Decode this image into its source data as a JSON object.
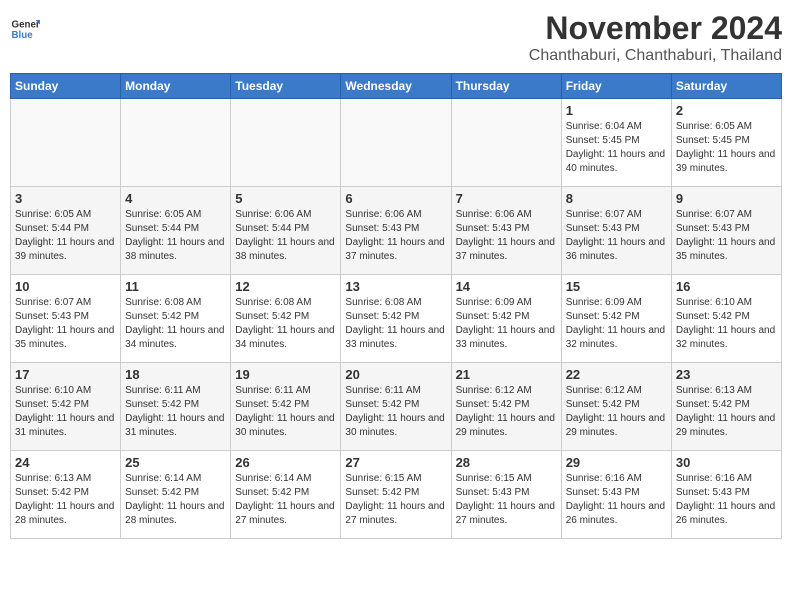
{
  "header": {
    "logo_general": "General",
    "logo_blue": "Blue",
    "title": "November 2024",
    "subtitle": "Chanthaburi, Chanthaburi, Thailand"
  },
  "days_of_week": [
    "Sunday",
    "Monday",
    "Tuesday",
    "Wednesday",
    "Thursday",
    "Friday",
    "Saturday"
  ],
  "weeks": [
    [
      {
        "day": "",
        "detail": ""
      },
      {
        "day": "",
        "detail": ""
      },
      {
        "day": "",
        "detail": ""
      },
      {
        "day": "",
        "detail": ""
      },
      {
        "day": "",
        "detail": ""
      },
      {
        "day": "1",
        "detail": "Sunrise: 6:04 AM\nSunset: 5:45 PM\nDaylight: 11 hours and 40 minutes."
      },
      {
        "day": "2",
        "detail": "Sunrise: 6:05 AM\nSunset: 5:45 PM\nDaylight: 11 hours and 39 minutes."
      }
    ],
    [
      {
        "day": "3",
        "detail": "Sunrise: 6:05 AM\nSunset: 5:44 PM\nDaylight: 11 hours and 39 minutes."
      },
      {
        "day": "4",
        "detail": "Sunrise: 6:05 AM\nSunset: 5:44 PM\nDaylight: 11 hours and 38 minutes."
      },
      {
        "day": "5",
        "detail": "Sunrise: 6:06 AM\nSunset: 5:44 PM\nDaylight: 11 hours and 38 minutes."
      },
      {
        "day": "6",
        "detail": "Sunrise: 6:06 AM\nSunset: 5:43 PM\nDaylight: 11 hours and 37 minutes."
      },
      {
        "day": "7",
        "detail": "Sunrise: 6:06 AM\nSunset: 5:43 PM\nDaylight: 11 hours and 37 minutes."
      },
      {
        "day": "8",
        "detail": "Sunrise: 6:07 AM\nSunset: 5:43 PM\nDaylight: 11 hours and 36 minutes."
      },
      {
        "day": "9",
        "detail": "Sunrise: 6:07 AM\nSunset: 5:43 PM\nDaylight: 11 hours and 35 minutes."
      }
    ],
    [
      {
        "day": "10",
        "detail": "Sunrise: 6:07 AM\nSunset: 5:43 PM\nDaylight: 11 hours and 35 minutes."
      },
      {
        "day": "11",
        "detail": "Sunrise: 6:08 AM\nSunset: 5:42 PM\nDaylight: 11 hours and 34 minutes."
      },
      {
        "day": "12",
        "detail": "Sunrise: 6:08 AM\nSunset: 5:42 PM\nDaylight: 11 hours and 34 minutes."
      },
      {
        "day": "13",
        "detail": "Sunrise: 6:08 AM\nSunset: 5:42 PM\nDaylight: 11 hours and 33 minutes."
      },
      {
        "day": "14",
        "detail": "Sunrise: 6:09 AM\nSunset: 5:42 PM\nDaylight: 11 hours and 33 minutes."
      },
      {
        "day": "15",
        "detail": "Sunrise: 6:09 AM\nSunset: 5:42 PM\nDaylight: 11 hours and 32 minutes."
      },
      {
        "day": "16",
        "detail": "Sunrise: 6:10 AM\nSunset: 5:42 PM\nDaylight: 11 hours and 32 minutes."
      }
    ],
    [
      {
        "day": "17",
        "detail": "Sunrise: 6:10 AM\nSunset: 5:42 PM\nDaylight: 11 hours and 31 minutes."
      },
      {
        "day": "18",
        "detail": "Sunrise: 6:11 AM\nSunset: 5:42 PM\nDaylight: 11 hours and 31 minutes."
      },
      {
        "day": "19",
        "detail": "Sunrise: 6:11 AM\nSunset: 5:42 PM\nDaylight: 11 hours and 30 minutes."
      },
      {
        "day": "20",
        "detail": "Sunrise: 6:11 AM\nSunset: 5:42 PM\nDaylight: 11 hours and 30 minutes."
      },
      {
        "day": "21",
        "detail": "Sunrise: 6:12 AM\nSunset: 5:42 PM\nDaylight: 11 hours and 29 minutes."
      },
      {
        "day": "22",
        "detail": "Sunrise: 6:12 AM\nSunset: 5:42 PM\nDaylight: 11 hours and 29 minutes."
      },
      {
        "day": "23",
        "detail": "Sunrise: 6:13 AM\nSunset: 5:42 PM\nDaylight: 11 hours and 29 minutes."
      }
    ],
    [
      {
        "day": "24",
        "detail": "Sunrise: 6:13 AM\nSunset: 5:42 PM\nDaylight: 11 hours and 28 minutes."
      },
      {
        "day": "25",
        "detail": "Sunrise: 6:14 AM\nSunset: 5:42 PM\nDaylight: 11 hours and 28 minutes."
      },
      {
        "day": "26",
        "detail": "Sunrise: 6:14 AM\nSunset: 5:42 PM\nDaylight: 11 hours and 27 minutes."
      },
      {
        "day": "27",
        "detail": "Sunrise: 6:15 AM\nSunset: 5:42 PM\nDaylight: 11 hours and 27 minutes."
      },
      {
        "day": "28",
        "detail": "Sunrise: 6:15 AM\nSunset: 5:43 PM\nDaylight: 11 hours and 27 minutes."
      },
      {
        "day": "29",
        "detail": "Sunrise: 6:16 AM\nSunset: 5:43 PM\nDaylight: 11 hours and 26 minutes."
      },
      {
        "day": "30",
        "detail": "Sunrise: 6:16 AM\nSunset: 5:43 PM\nDaylight: 11 hours and 26 minutes."
      }
    ]
  ]
}
